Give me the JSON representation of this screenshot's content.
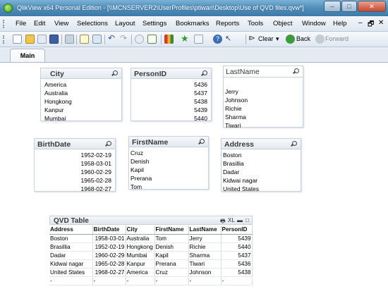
{
  "window": {
    "title": "QlikView x64 Personal Edition - [\\\\MCNSERVER2\\UserProfiles\\ptiwari\\Desktop\\Use of QVD files.qvw*]",
    "minimize": "–",
    "maximize": "□",
    "close": "✕"
  },
  "menu": {
    "items": [
      "File",
      "Edit",
      "View",
      "Selections",
      "Layout",
      "Settings",
      "Bookmarks",
      "Reports",
      "Tools",
      "Object",
      "Window",
      "Help"
    ],
    "mdi_minimize": "–",
    "mdi_restore": "🗗",
    "mdi_close": "✕"
  },
  "toolbar": {
    "clear_label": "Clear",
    "back_label": "Back",
    "forward_label": "Forward"
  },
  "tabs": [
    "Main"
  ],
  "listboxes": {
    "city": {
      "caption": "City",
      "values": [
        "America",
        "Australia",
        "Hongkong",
        "Kanpur",
        "Mumbai"
      ]
    },
    "personid": {
      "caption": "PersonID",
      "values": [
        "5436",
        "5437",
        "5438",
        "5439",
        "5440"
      ]
    },
    "lastname": {
      "caption": "LastName",
      "values": [
        "",
        "Jerry",
        "Johnson",
        "Richie",
        "Sharma",
        "Tiwari"
      ]
    },
    "birthdate": {
      "caption": "BirthDate",
      "values": [
        "1952-02-19",
        "1958-03-01",
        "1960-02-29",
        "1965-02-28",
        "1968-02-27"
      ]
    },
    "firstname": {
      "caption": "FirstName",
      "values": [
        "Cruz",
        "Denish",
        "Kapil",
        "Prerana",
        "Tom"
      ]
    },
    "address": {
      "caption": "Address",
      "values": [
        "Boston",
        "Brasillia",
        "Dadar",
        "Kidwai nagar",
        "United States"
      ]
    }
  },
  "qvd_table": {
    "caption": "QVD Table",
    "controls": {
      "print": "🖶",
      "xl": "XL",
      "minimize": "▬",
      "maximize": "□"
    },
    "columns": [
      "Address",
      "BirthDate",
      "City",
      "FirstName",
      "LastName",
      "PersonID"
    ],
    "rows": [
      [
        "Boston",
        "1958-03-01",
        "Australia",
        "Tom",
        "Jerry",
        "5439"
      ],
      [
        "Brasillia",
        "1952-02-19",
        "Hongkong",
        "Denish",
        "Richie",
        "5440"
      ],
      [
        "Dadar",
        "1960-02-29",
        "Mumbai",
        "Kapil",
        "Sharma",
        "5437"
      ],
      [
        "Kidwai nagar",
        "1965-02-28",
        "Kanpur",
        "Prerana",
        "Tiwari",
        "5436"
      ],
      [
        "United States",
        "1968-02-27",
        "America",
        "Cruz",
        "Johnson",
        "5438"
      ],
      [
        "-",
        "-",
        "-",
        "-",
        "-",
        "-"
      ]
    ]
  }
}
